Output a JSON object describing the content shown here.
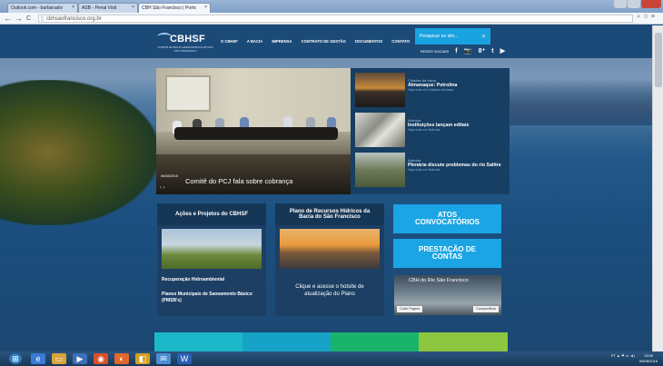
{
  "browser": {
    "tabs": [
      {
        "label": "Outlook.com - barbarasilv"
      },
      {
        "label": "ASB - Penal Vistt"
      },
      {
        "label": "CBH São Francisco | Porto"
      }
    ],
    "url": "cbhsaofrancisco.org.br",
    "back": "←",
    "forward": "→",
    "reload": "C"
  },
  "header": {
    "logo_name": "CBHSF",
    "logo_sub": "COMITÊ DA BACIA HIDROGRÁFICA DO RIO SÃO FRANCISCO",
    "menu": [
      "O CBHSF",
      "A BACIA",
      "IMPRENSA",
      "CONTRATO DE GESTÃO",
      "DOCUMENTOS",
      "CONTATO"
    ],
    "search_placeholder": "Pesquisar no site...",
    "social_label": "REDES SOCIAIS",
    "social_icons": [
      "f",
      "📷",
      "8⁺",
      "t",
      "▶"
    ]
  },
  "hero": {
    "date": "06/08/2015",
    "caption": "Comitê do PCJ fala sobre cobrança",
    "dots": "‹  ›"
  },
  "news": [
    {
      "category": "Cidades da bacia",
      "title": "Almanaque: Petrolina",
      "more": "Veja mais em Cidades da bacia"
    },
    {
      "category": "Notícias",
      "title": "Instituições lançam editais",
      "more": "Veja mais em Notícias"
    },
    {
      "category": "Notícias",
      "title": "Plenária discute problemas do rio Salitre",
      "more": "Veja mais em Notícias"
    }
  ],
  "boxes": {
    "acoes_title": "Ações e Projetos do CBHSF",
    "acoes_links": [
      "Recuperação Hidroambiental",
      "Planos Municipais de Saneamento Básico (PMSB's)"
    ],
    "plano_title": "Plano de Recursos Hídricos da Bacia do São Francisco",
    "plano_text": "Clique e acesse o hotsite de atualização do Plano",
    "cta1": "ATOS CONVOCATÓRIOS",
    "cta2": "PRESTAÇÃO DE CONTAS",
    "fb_title": "CBH do Rio São Francisco",
    "fb_btn1": "Curtir Página",
    "fb_btn2": "Compartilhar"
  },
  "strip_colors": [
    "#1ab8c9",
    "#17a2c7",
    "#19b36b",
    "#8dc63f"
  ],
  "taskbar": {
    "lang": "PT",
    "time": "13:50",
    "date": "05/08/2015"
  }
}
